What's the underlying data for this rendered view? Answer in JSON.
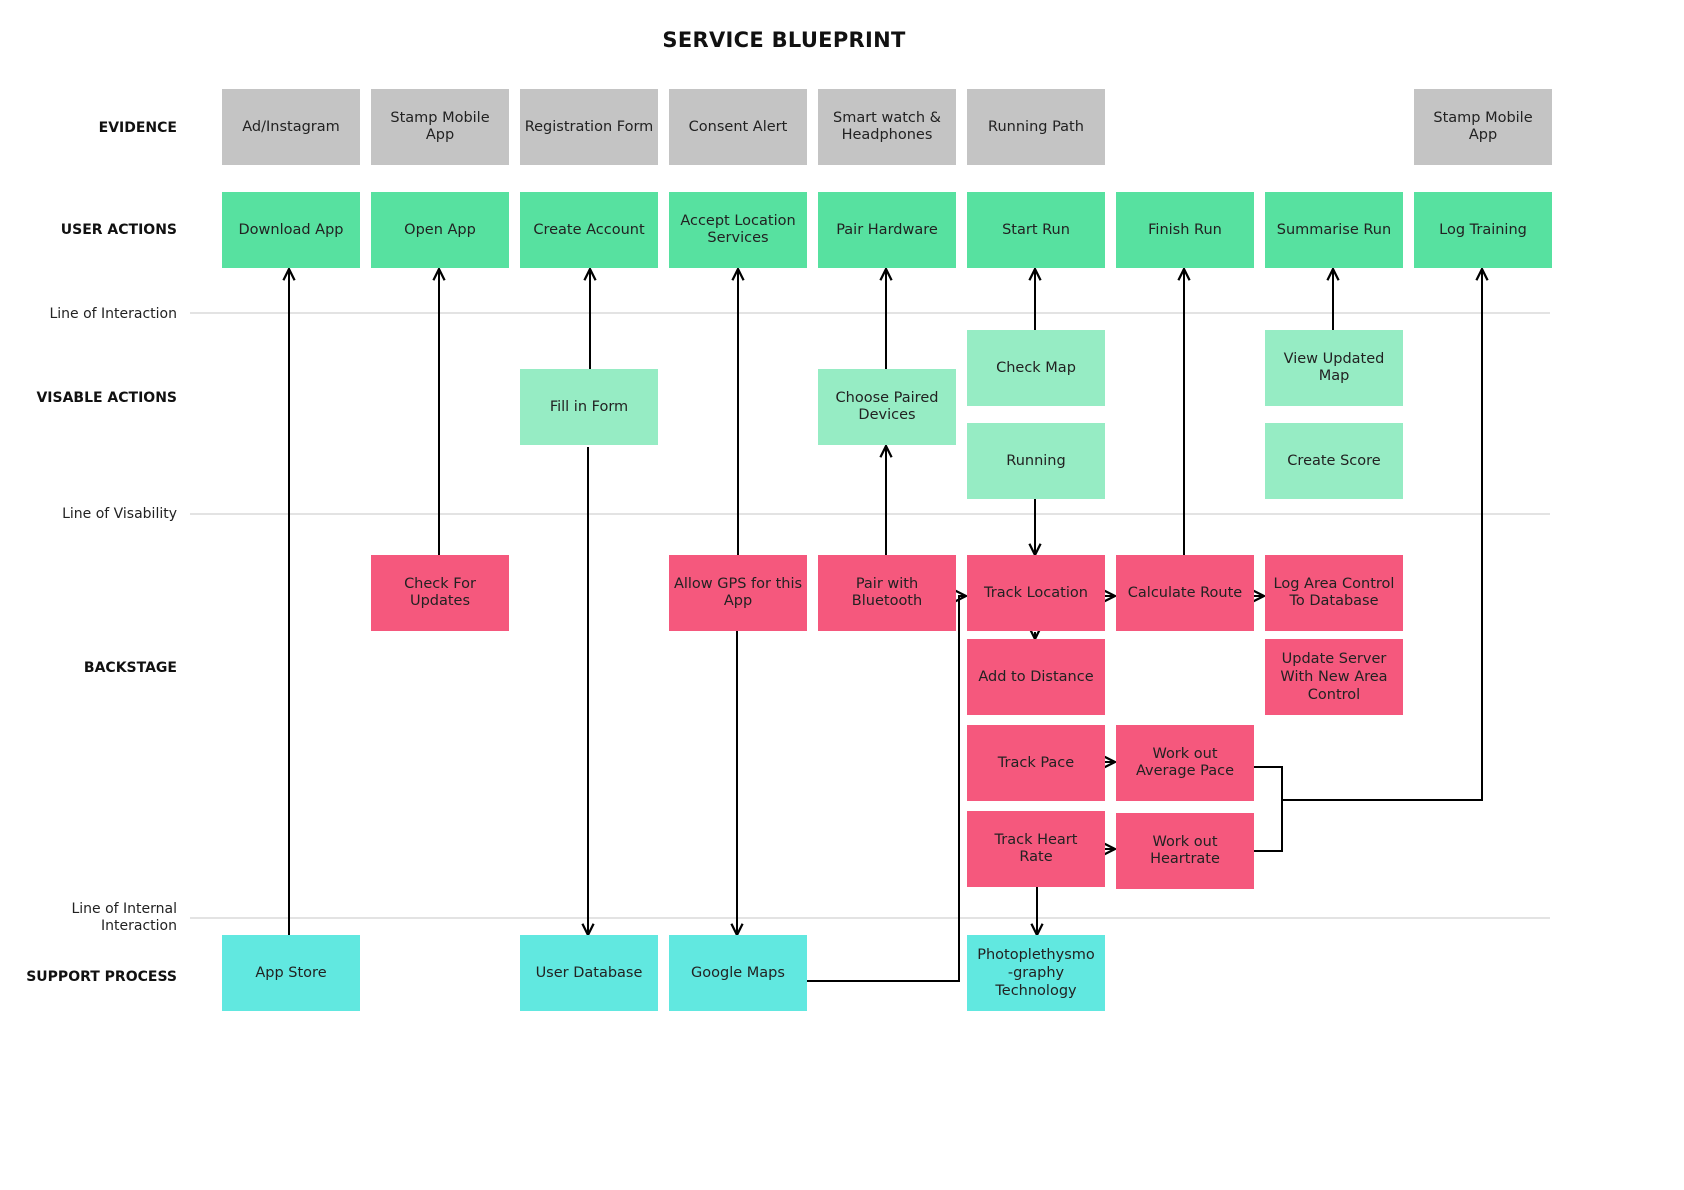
{
  "title": "SERVICE BLUEPRINT",
  "lanes": {
    "evidence": "EVIDENCE",
    "user_actions": "USER ACTIONS",
    "visible_actions": "VISABLE ACTIONS",
    "backstage": "BACKSTAGE",
    "support_process": "SUPPORT PROCESS"
  },
  "lines": {
    "interaction": "Line of Interaction",
    "visibility": "Line of Visability",
    "internal_interaction_1": "Line of Internal",
    "internal_interaction_2": "Interaction"
  },
  "colors": {
    "evidence": "#c4c4c4",
    "user_actions": "#57e1a0",
    "visible_actions": "#96ecc4",
    "backstage": "#f5587d",
    "support_process": "#61e8e0",
    "divider": "#e3e3e3"
  },
  "evidence": [
    "Ad/Instagram",
    "Stamp Mobile App",
    "Registration Form",
    "Consent Alert",
    "Smart watch & Headphones",
    "Running Path",
    "Stamp Mobile App"
  ],
  "user_actions": [
    "Download App",
    "Open App",
    "Create Account",
    "Accept Location Services",
    "Pair Hardware",
    "Start Run",
    "Finish Run",
    "Summarise Run",
    "Log Training"
  ],
  "visible_actions": [
    "Fill in Form",
    "Choose Paired Devices",
    "Check Map",
    "Running",
    "View Updated Map",
    "Create Score"
  ],
  "backstage": [
    "Check For Updates",
    "Allow GPS for this App",
    "Pair with Bluetooth",
    "Track Location",
    "Calculate Route",
    "Log Area Control To Database",
    "Add to Distance",
    "Update Server With New Area Control",
    "Track Pace",
    "Work out Average Pace",
    "Track Heart Rate",
    "Work out Heartrate"
  ],
  "support_process": [
    "App Store",
    "User Database",
    "Google Maps",
    "Photoplethysmo -graphy Technology"
  ]
}
